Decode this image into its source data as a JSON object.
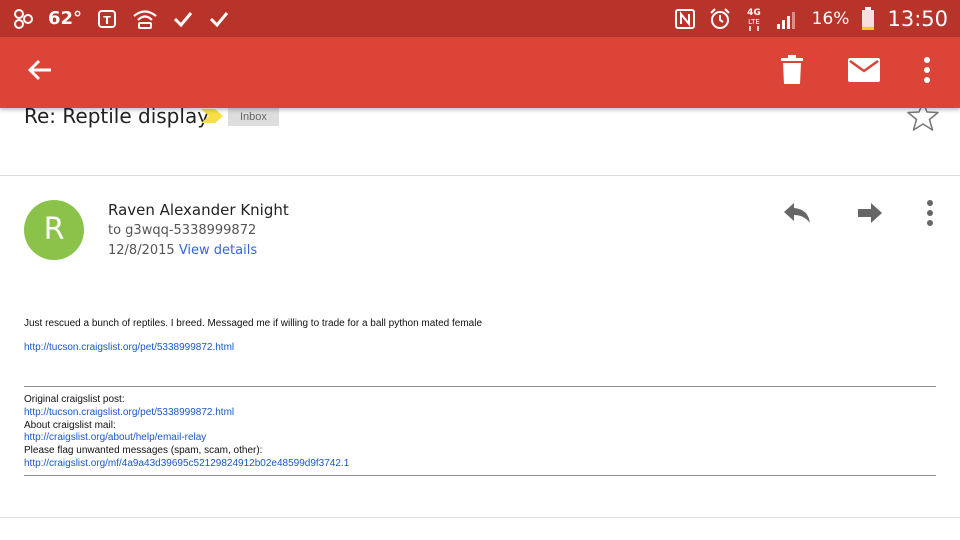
{
  "status_bar": {
    "temperature": "62°",
    "battery_percent": "16%",
    "time": "13:50",
    "network_badge_top": "4G",
    "network_badge_bottom": "LTE",
    "battery_level": 0.16,
    "icons_left": [
      "notification-icon",
      "weather-icon",
      "tmobile-icon",
      "wifi-hotspot-icon",
      "check-icon",
      "check-icon"
    ],
    "icons_right": [
      "nfc-icon",
      "alarm-icon",
      "lte-icon",
      "signal-icon",
      "battery-icon"
    ]
  },
  "app_bar": {
    "color": "#db4437",
    "actions": [
      "back-arrow-icon",
      "delete-icon",
      "mark-unread-icon",
      "more-vert-icon"
    ]
  },
  "subject": {
    "title": "Re: Reptile display",
    "label": "Inbox",
    "importance_color": "#f7df47"
  },
  "message": {
    "sender_initial": "R",
    "sender_name": "Raven Alexander Knight",
    "recipient": "to g3wqq-5338999872",
    "date": "12/8/2015",
    "view_details": "View details",
    "avatar_color": "#8bc34a",
    "body_text": "Just rescued a bunch of reptiles. I breed. Messaged me if willing to trade for a ball python mated female",
    "body_link": "http://tucson.craigslist.org/pet/5338999872.html",
    "footer": {
      "original_post_label": "Original craigslist post:",
      "original_post_link": "http://tucson.craigslist.org/pet/5338999872.html",
      "about_mail_label": "About craigslist mail:",
      "about_mail_link": "http://craigslist.org/about/help/email-relay",
      "flag_label": "Please flag unwanted messages (spam, scam, other):",
      "flag_link": "http://craigslist.org/mf/4a9a43d39695c52129824912b02e48599d9f3742.1"
    }
  }
}
